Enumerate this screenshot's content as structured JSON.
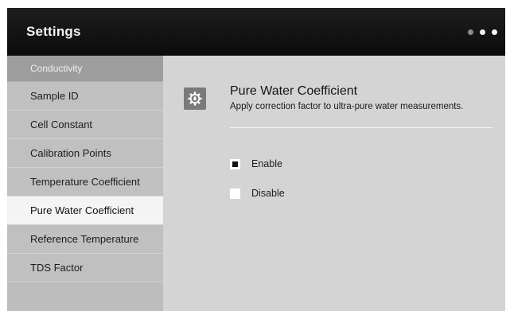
{
  "header": {
    "title": "Settings"
  },
  "sidebar": {
    "section_label": "Conductivity",
    "items": [
      {
        "label": "Sample ID",
        "active": false
      },
      {
        "label": "Cell Constant",
        "active": false
      },
      {
        "label": "Calibration Points",
        "active": false
      },
      {
        "label": "Temperature Coefficient",
        "active": false
      },
      {
        "label": "Pure Water Coefficient",
        "active": true
      },
      {
        "label": "Reference Temperature",
        "active": false
      },
      {
        "label": "TDS Factor",
        "active": false
      }
    ]
  },
  "detail": {
    "icon": "water-drop-gear-icon",
    "title": "Pure Water Coefficient",
    "description": "Apply correction factor to ultra-pure water measurements.",
    "options": [
      {
        "label": "Enable",
        "selected": true
      },
      {
        "label": "Disable",
        "selected": false
      }
    ]
  },
  "colors": {
    "titlebar": "#111111",
    "sidebar": "#c0c0c0",
    "active_item": "#f4f4f4",
    "content": "#d4d4d4"
  }
}
